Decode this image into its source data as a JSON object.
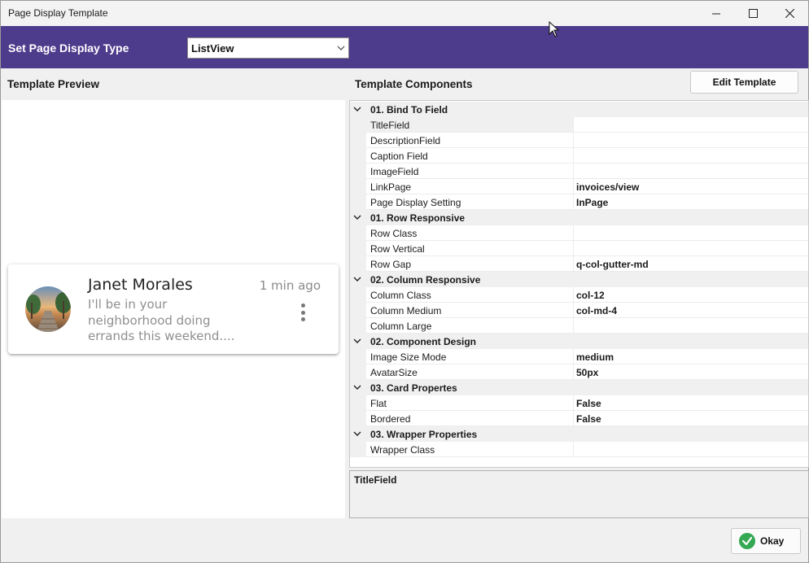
{
  "window": {
    "title": "Page Display Template"
  },
  "header": {
    "label": "Set Page Display Type",
    "display_type_value": "ListView"
  },
  "preview": {
    "heading": "Template Preview",
    "card": {
      "name": "Janet Morales",
      "time": "1 min ago",
      "description": "I'll be in your neighborhood doing errands this weekend...."
    }
  },
  "components": {
    "heading": "Template Components",
    "edit_button": "Edit Template",
    "rows": [
      {
        "type": "category",
        "label": "01. Bind To Field"
      },
      {
        "type": "prop",
        "name": "TitleField",
        "value": ""
      },
      {
        "type": "prop",
        "name": "DescriptionField",
        "value": ""
      },
      {
        "type": "prop",
        "name": "Caption Field",
        "value": ""
      },
      {
        "type": "prop",
        "name": "ImageField",
        "value": ""
      },
      {
        "type": "prop",
        "name": "LinkPage",
        "value": "invoices/view"
      },
      {
        "type": "prop",
        "name": "Page Display Setting",
        "value": "InPage"
      },
      {
        "type": "category",
        "label": "01. Row Responsive"
      },
      {
        "type": "prop",
        "name": "Row Class",
        "value": ""
      },
      {
        "type": "prop",
        "name": "Row Vertical",
        "value": ""
      },
      {
        "type": "prop",
        "name": "Row Gap",
        "value": "q-col-gutter-md"
      },
      {
        "type": "category",
        "label": "02. Column Responsive"
      },
      {
        "type": "prop",
        "name": "Column Class",
        "value": "col-12"
      },
      {
        "type": "prop",
        "name": "Column Medium",
        "value": "col-md-4"
      },
      {
        "type": "prop",
        "name": "Column Large",
        "value": ""
      },
      {
        "type": "category",
        "label": "02. Component Design"
      },
      {
        "type": "prop",
        "name": "Image Size Mode",
        "value": "medium"
      },
      {
        "type": "prop",
        "name": "AvatarSize",
        "value": "50px"
      },
      {
        "type": "category",
        "label": "03. Card Propertes"
      },
      {
        "type": "prop",
        "name": "Flat",
        "value": "False"
      },
      {
        "type": "prop",
        "name": "Bordered",
        "value": "False"
      },
      {
        "type": "category",
        "label": "03. Wrapper Properties"
      },
      {
        "type": "prop",
        "name": "Wrapper Class",
        "value": ""
      }
    ],
    "selected_description_title": "TitleField"
  },
  "footer": {
    "okay_button": "Okay"
  },
  "colors": {
    "header_purple": "#4d3b8c",
    "ok_green": "#34a853"
  }
}
